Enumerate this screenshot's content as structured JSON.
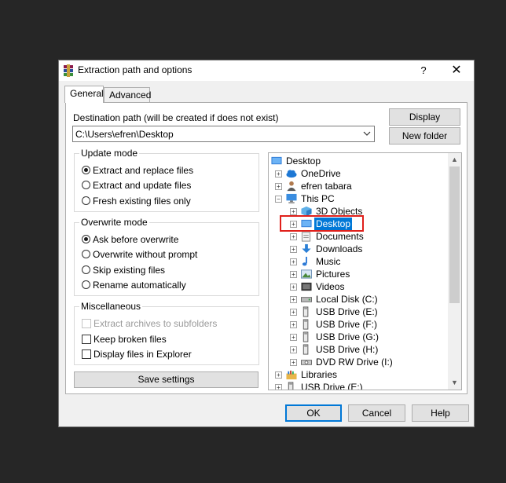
{
  "window": {
    "title": "Extraction path and options",
    "help": "?",
    "close": "✕"
  },
  "tabs": [
    {
      "label": "General"
    },
    {
      "label": "Advanced"
    }
  ],
  "destination": {
    "label": "Destination path (will be created if does not exist)",
    "value": "C:\\Users\\efren\\Desktop"
  },
  "buttons": {
    "display": "Display",
    "new_folder": "New folder",
    "save_settings": "Save settings",
    "ok": "OK",
    "cancel": "Cancel",
    "help": "Help"
  },
  "update_mode": {
    "title": "Update mode",
    "options": [
      "Extract and replace files",
      "Extract and update files",
      "Fresh existing files only"
    ],
    "selected": 0
  },
  "overwrite_mode": {
    "title": "Overwrite mode",
    "options": [
      "Ask before overwrite",
      "Overwrite without prompt",
      "Skip existing files",
      "Rename automatically"
    ],
    "selected": 0
  },
  "misc": {
    "title": "Miscellaneous",
    "options": [
      {
        "label": "Extract archives to subfolders",
        "checked": false,
        "disabled": true
      },
      {
        "label": "Keep broken files",
        "checked": false,
        "disabled": false
      },
      {
        "label": "Display files in Explorer",
        "checked": false,
        "disabled": false
      }
    ]
  },
  "tree": {
    "items": [
      {
        "label": "Desktop",
        "icon": "desktop-icon"
      },
      {
        "label": "OneDrive",
        "icon": "cloud-icon"
      },
      {
        "label": "efren tabara",
        "icon": "user-icon"
      },
      {
        "label": "This PC",
        "icon": "computer-icon"
      },
      {
        "label": "3D Objects",
        "icon": "cube-icon"
      },
      {
        "label": "Desktop",
        "icon": "desktop-icon"
      },
      {
        "label": "Documents",
        "icon": "documents-icon"
      },
      {
        "label": "Downloads",
        "icon": "download-icon"
      },
      {
        "label": "Music",
        "icon": "music-icon"
      },
      {
        "label": "Pictures",
        "icon": "pictures-icon"
      },
      {
        "label": "Videos",
        "icon": "videos-icon"
      },
      {
        "label": "Local Disk (C:)",
        "icon": "disk-icon"
      },
      {
        "label": "USB Drive (E:)",
        "icon": "usb-icon"
      },
      {
        "label": "USB Drive (F:)",
        "icon": "usb-icon"
      },
      {
        "label": "USB Drive (G:)",
        "icon": "usb-icon"
      },
      {
        "label": "USB Drive (H:)",
        "icon": "usb-icon"
      },
      {
        "label": "DVD RW Drive (I:)",
        "icon": "dvd-icon"
      },
      {
        "label": "Libraries",
        "icon": "library-icon"
      },
      {
        "label": "USB Drive (E:)",
        "icon": "usb-icon"
      }
    ],
    "selected": 5
  },
  "colors": {
    "accent": "#0078d7",
    "highlight": "#e0201b"
  }
}
